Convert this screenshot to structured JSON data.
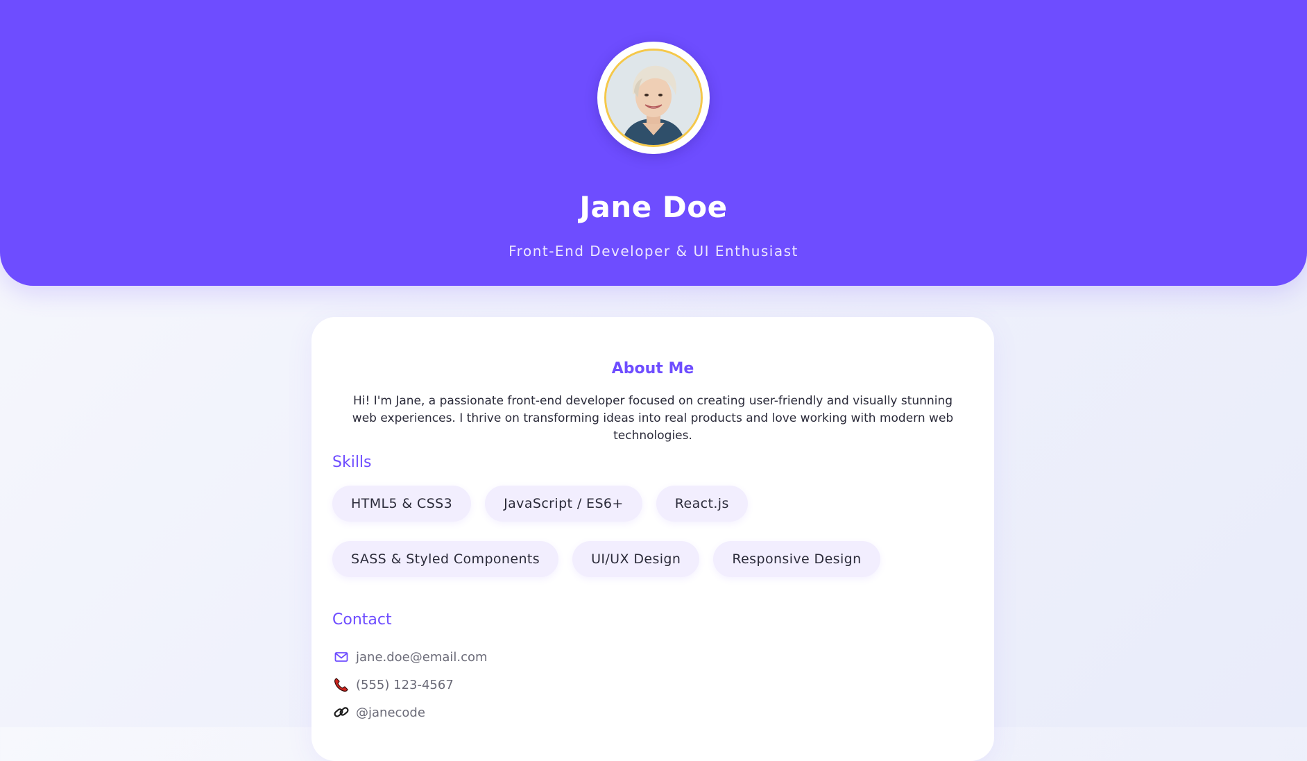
{
  "profile": {
    "name": "Jane Doe",
    "title": "Front-End Developer & UI Enthusiast",
    "avatar_icon": "profile-photo"
  },
  "about": {
    "heading": "About Me",
    "text": "Hi! I'm Jane, a passionate front-end developer focused on creating user-friendly and visually stunning web experiences. I thrive on transforming ideas into real products and love working with modern web technologies."
  },
  "skills": {
    "heading": "Skills",
    "items": [
      "HTML5 & CSS3",
      "JavaScript / ES6+",
      "React.js",
      "SASS & Styled Components",
      "UI/UX Design",
      "Responsive Design"
    ]
  },
  "contact": {
    "heading": "Contact",
    "items": [
      {
        "icon": "mail-icon",
        "text": "jane.doe@email.com"
      },
      {
        "icon": "phone-icon",
        "text": "(555) 123-4567"
      },
      {
        "icon": "link-icon",
        "text": "@janecode"
      }
    ]
  },
  "colors": {
    "accent": "#6e4dff",
    "chip_bg": "#f2eefe",
    "avatar_ring": "#f5c84a"
  }
}
